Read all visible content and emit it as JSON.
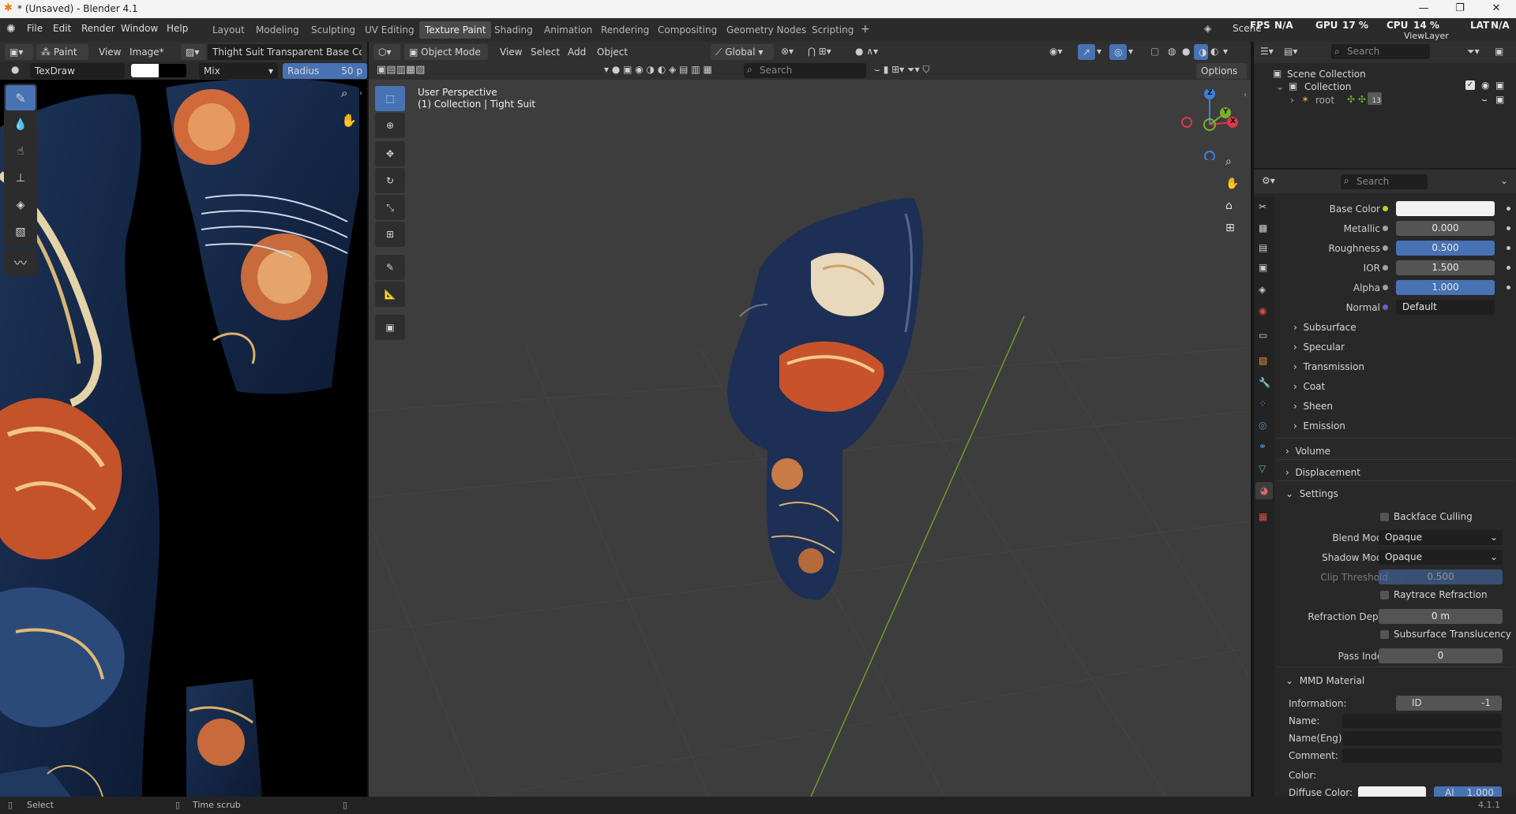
{
  "window": {
    "title": "* (Unsaved) - Blender 4.1",
    "min": "—",
    "max": "❐",
    "close": "✕"
  },
  "menus": [
    "File",
    "Edit",
    "Render",
    "Window",
    "Help"
  ],
  "workspaces": [
    "Layout",
    "Modeling",
    "Sculpting",
    "UV Editing",
    "Texture Paint",
    "Shading",
    "Animation",
    "Rendering",
    "Compositing",
    "Geometry Nodes",
    "Scripting"
  ],
  "active_workspace": "Texture Paint",
  "add_workspace": "+",
  "topbar_right": {
    "scene": "Scene",
    "fps_label": "FPS",
    "fps_value": "N/A",
    "gpu_label": "GPU",
    "gpu_value": "17 %",
    "cpu_label": "CPU",
    "cpu_value": "14 %",
    "lat_label": "LAT",
    "lat_value": "N/A",
    "viewlayer": "ViewLayer"
  },
  "image_editor": {
    "mode": "Paint",
    "menu_view": "View",
    "menu_image": "Image*",
    "image_name": "Thight Suit Transparent Base Color",
    "brush": "TexDraw",
    "blend": "Mix",
    "radius_label": "Radius",
    "radius_value": "50 p"
  },
  "viewport": {
    "mode": "Object Mode",
    "menus": [
      "View",
      "Select",
      "Add",
      "Object"
    ],
    "orientation": "Global",
    "search_placeholder": "Search",
    "options": "Options",
    "perspective": "User Perspective",
    "collection_info": "(1) Collection | Tight Suit",
    "gizmo": {
      "z": "Z",
      "y": "Y",
      "x": "X"
    }
  },
  "outliner": {
    "search_placeholder": "Search",
    "scene_collection": "Scene Collection",
    "collection": "Collection",
    "root": "root",
    "root_count": "13"
  },
  "properties": {
    "search_placeholder": "Search",
    "fields": [
      {
        "label": "Base Color",
        "value": ""
      },
      {
        "label": "Metallic",
        "value": "0.000"
      },
      {
        "label": "Roughness",
        "value": "0.500"
      },
      {
        "label": "IOR",
        "value": "1.500"
      },
      {
        "label": "Alpha",
        "value": "1.000"
      },
      {
        "label": "Normal",
        "value": "Default"
      }
    ],
    "subsections": [
      "Subsurface",
      "Specular",
      "Transmission",
      "Coat",
      "Sheen",
      "Emission"
    ],
    "panels": [
      "Volume",
      "Displacement",
      "Settings"
    ],
    "settings": {
      "backface_culling": "Backface Culling",
      "blend_mode_label": "Blend Mode",
      "blend_mode": "Opaque",
      "shadow_mode_label": "Shadow Mode",
      "shadow_mode": "Opaque",
      "clip_label": "Clip Threshold",
      "clip_value": "0.500",
      "raytrace": "Raytrace Refraction",
      "refraction_depth_label": "Refraction Depth",
      "refraction_depth": "0 m",
      "subsurface_translucency": "Subsurface Translucency",
      "pass_index_label": "Pass Index",
      "pass_index": "0"
    },
    "mmd": {
      "title": "MMD Material",
      "information_label": "Information:",
      "id_label": "ID",
      "id_value": "-1",
      "name_label": "Name:",
      "name_eng_label": "Name(Eng):",
      "comment_label": "Comment:",
      "color_label": "Color:",
      "diffuse_label": "Diffuse Color:",
      "alpha_label": "Al",
      "alpha_value": "1.000"
    }
  },
  "statusbar": {
    "select": "Select",
    "time_scrub": "Time scrub",
    "version": "4.1.1"
  },
  "colors": {
    "accent": "#4772b3",
    "header": "#303030",
    "panel": "#282828",
    "viewport": "#3d3d3d"
  }
}
